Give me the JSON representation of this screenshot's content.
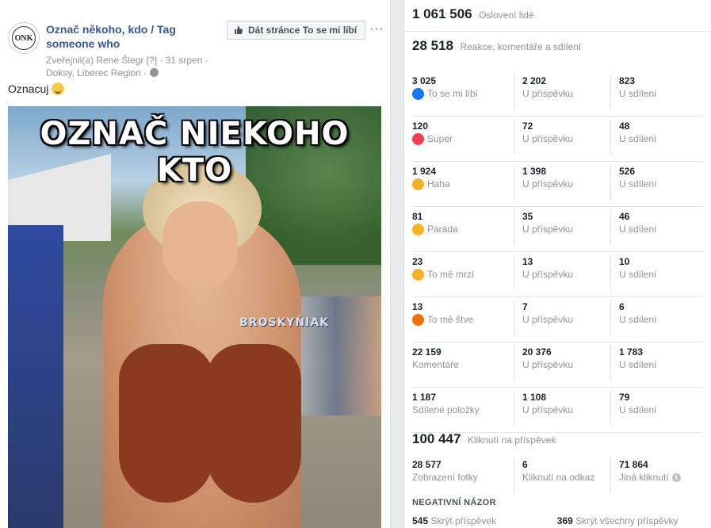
{
  "post": {
    "page_name": "Označ někoho, kdo / Tag someone who",
    "avatar_text": "ONK",
    "like_button": "Dát stránce To se mi líbí",
    "more": "···",
    "author_line": "Zveřejnil(a) René Šlegr [?] · 31 srpen ·",
    "location_line": "Doksy, Liberec Region ·",
    "text": "Oznacuj",
    "photo_title": "OZNAČ NIEKOHO KTO",
    "photo_watermark": "BROSKYŇIAK"
  },
  "insights": {
    "reach": {
      "value": "1 061 506",
      "label": "Oslovení lidé"
    },
    "engagement": {
      "value": "28 518",
      "label": "Reakce, komentáře a sdílení"
    },
    "rows": [
      {
        "icon": "like-icon",
        "color": "#1877f2",
        "total": "3 025",
        "name": "To se mi líbí",
        "on_post": "2 202",
        "on_post_label": "U příspěvku",
        "on_shares": "823",
        "on_shares_label": "U sdílení"
      },
      {
        "icon": "love-icon",
        "color": "#f33e58",
        "total": "120",
        "name": "Super",
        "on_post": "72",
        "on_post_label": "U příspěvku",
        "on_shares": "48",
        "on_shares_label": "U sdílení"
      },
      {
        "icon": "haha-icon",
        "color": "#f7b125",
        "total": "1 924",
        "name": "Haha",
        "on_post": "1 398",
        "on_post_label": "U příspěvku",
        "on_shares": "526",
        "on_shares_label": "U sdílení"
      },
      {
        "icon": "wow-icon",
        "color": "#f7b125",
        "total": "81",
        "name": "Paráda",
        "on_post": "35",
        "on_post_label": "U příspěvku",
        "on_shares": "46",
        "on_shares_label": "U sdílení"
      },
      {
        "icon": "sad-icon",
        "color": "#f7b125",
        "total": "23",
        "name": "To mě mrzí",
        "on_post": "13",
        "on_post_label": "U příspěvku",
        "on_shares": "10",
        "on_shares_label": "U sdílení"
      },
      {
        "icon": "angry-icon",
        "color": "#e9710f",
        "total": "13",
        "name": "To mě štve",
        "on_post": "7",
        "on_post_label": "U příspěvku",
        "on_shares": "6",
        "on_shares_label": "U sdílení"
      },
      {
        "icon": "",
        "color": "",
        "total": "22 159",
        "name": "Komentáře",
        "on_post": "20 376",
        "on_post_label": "U příspěvku",
        "on_shares": "1 783",
        "on_shares_label": "U sdílení"
      },
      {
        "icon": "",
        "color": "",
        "total": "1 187",
        "name": "Sdílené položky",
        "on_post": "1 108",
        "on_post_label": "U příspěvku",
        "on_shares": "79",
        "on_shares_label": "U sdílení"
      }
    ],
    "clicks": {
      "value": "100 447",
      "label": "Kliknutí na příspěvek",
      "items": [
        {
          "value": "28 577",
          "label": "Zobrazení fotky"
        },
        {
          "value": "6",
          "label": "Kliknutí na odkaz"
        },
        {
          "value": "71 864",
          "label": "Jiná kliknutí"
        }
      ]
    },
    "negative": {
      "title": "NEGATIVNÍ NÁZOR",
      "items": [
        {
          "value": "545",
          "label": "Skrýt příspěvek"
        },
        {
          "value": "369",
          "label": "Skrýt všechny příspěvky"
        }
      ]
    }
  }
}
